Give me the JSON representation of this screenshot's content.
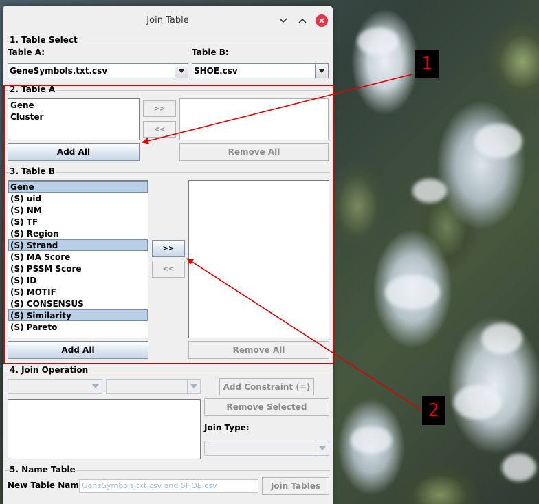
{
  "window": {
    "title": "Join Table"
  },
  "table_select": {
    "section_label": "1. Table Select",
    "table_a_label": "Table A:",
    "table_a_value": "GeneSymbols.txt.csv",
    "table_b_label": "Table B:",
    "table_b_value": "SHOE.csv"
  },
  "table_a": {
    "section_label": "2. Table A",
    "available": [
      "Gene",
      "Cluster"
    ],
    "add_label": ">>",
    "remove_label": "<<",
    "add_all_label": "Add All",
    "remove_all_label": "Remove All"
  },
  "table_b": {
    "section_label": "3. Table B",
    "available": [
      "Gene",
      "(S) uid",
      "(S) NM",
      "(S) TF",
      "(S) Region",
      "(S) Strand",
      "(S) MA Score",
      "(S) PSSM Score",
      "(S) ID",
      "(S) MOTIF",
      "(S) CONSENSUS",
      "(S) Similarity",
      "(S) Pareto"
    ],
    "selected_items": [
      "Gene",
      "(S) Strand",
      "(S) Similarity"
    ],
    "add_label": ">>",
    "remove_label": "<<",
    "add_all_label": "Add All",
    "remove_all_label": "Remove All"
  },
  "join_operation": {
    "section_label": "4. Join Operation",
    "add_constraint_label": "Add Constraint (=)",
    "remove_selected_label": "Remove Selected",
    "join_type_label": "Join Type:"
  },
  "name_table": {
    "section_label": "5. Name Table",
    "new_name_label": "New Table Name:",
    "new_name_value": "GeneSymbols.txt.csv and SHOE.csv",
    "join_button_label": "Join Tables"
  },
  "annotations": [
    {
      "label": "1"
    },
    {
      "label": "2"
    }
  ],
  "colors": {
    "annotation": "#e00000",
    "selection": "#b8cfe5",
    "close_button": "#e3354a"
  },
  "icons": [
    "chevron-down-icon",
    "chevron-up-icon",
    "close-icon",
    "dropdown-arrow-icon"
  ]
}
